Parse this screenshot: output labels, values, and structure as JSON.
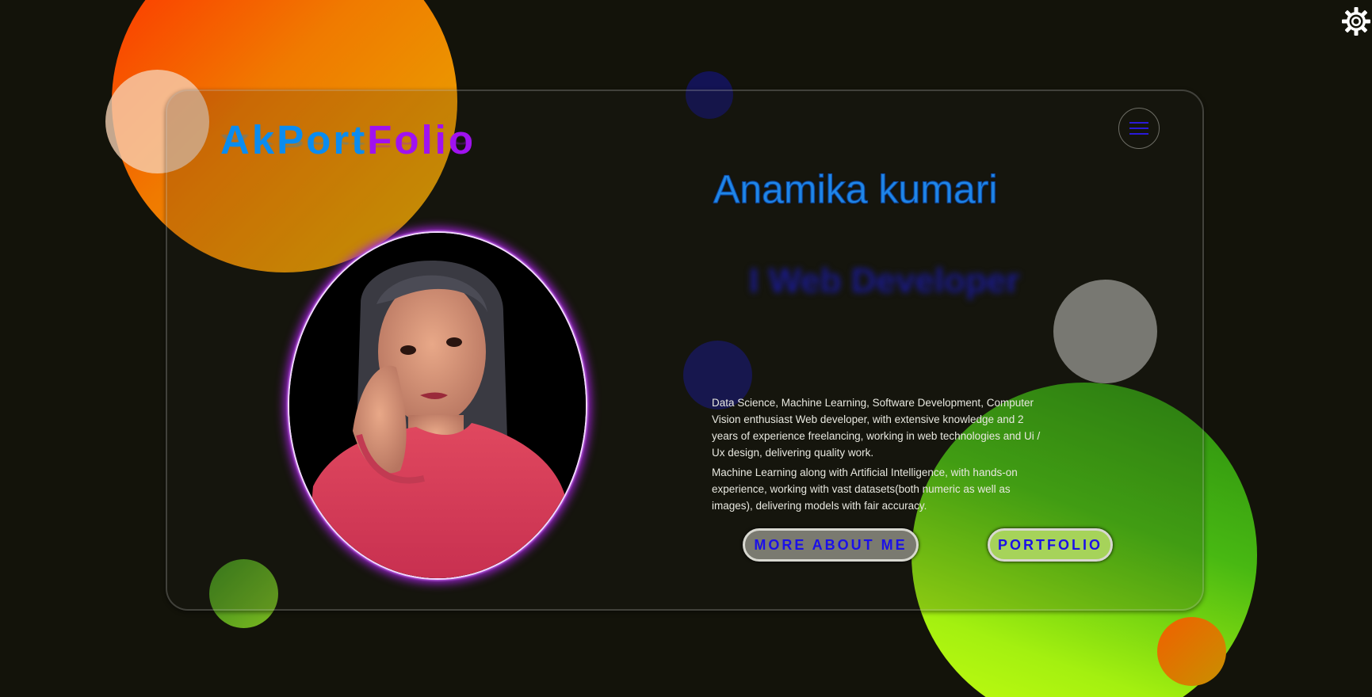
{
  "brand": {
    "part1": "AkPort",
    "part2": "Folio",
    "color1": "#0a8cf0",
    "color2": "#a012f0"
  },
  "header": {
    "menu_icon": "hamburger-menu-icon",
    "settings_icon": "gear-icon"
  },
  "hero": {
    "name": "Anamika kumari",
    "role": "I Web Developer",
    "paragraphs": [
      "Data Science, Machine Learning, Software Development, Computer Vision enthusiast Web developer, with extensive knowledge and 2 years of experience freelancing, working in web technologies and Ui / Ux design, delivering quality work.",
      "Machine Learning along with Artificial Intelligence, with hands-on experience, working with vast datasets(both numeric as well as images), delivering models with fair accuracy."
    ]
  },
  "buttons": {
    "about": "MORE ABOUT ME",
    "portfolio": "PORTFOLIO"
  },
  "colors": {
    "background": "#13130a",
    "name": "#1f86e8",
    "button_text": "#1b10e8",
    "photo_glow": "#a020d8"
  }
}
